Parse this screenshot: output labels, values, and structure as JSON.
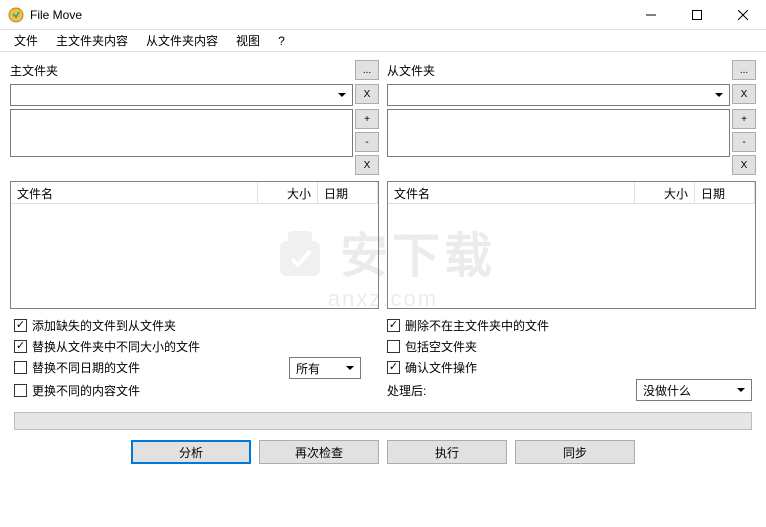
{
  "window": {
    "title": "File Move"
  },
  "menu": {
    "file": "文件",
    "mainFolder": "主文件夹内容",
    "subFolder": "从文件夹内容",
    "view": "视图",
    "help": "?"
  },
  "panes": {
    "main": {
      "label": "主文件夹",
      "browse": "..."
    },
    "sub": {
      "label": "从文件夹",
      "browse": "..."
    }
  },
  "buttons": {
    "x": "X",
    "plus": "+",
    "minus": "-"
  },
  "columns": {
    "name": "文件名",
    "size": "大小",
    "date": "日期"
  },
  "options": {
    "addMissing": "添加缺失的文件到从文件夹",
    "replaceDiffSize": "替换从文件夹中不同大小的文件",
    "replaceDiffDate": "替换不同日期的文件",
    "replaceDiffContent": "更换不同的内容文件",
    "deleteNotInMain": "删除不在主文件夹中的文件",
    "includeEmpty": "包括空文件夹",
    "confirmOps": "确认文件操作",
    "processAfter": "处理后:",
    "allSelect": "所有",
    "doNothing": "没做什么"
  },
  "actions": {
    "analyze": "分析",
    "recheck": "再次检查",
    "execute": "执行",
    "sync": "同步"
  },
  "watermark": {
    "main": "安下载",
    "sub": "anxz.com"
  }
}
